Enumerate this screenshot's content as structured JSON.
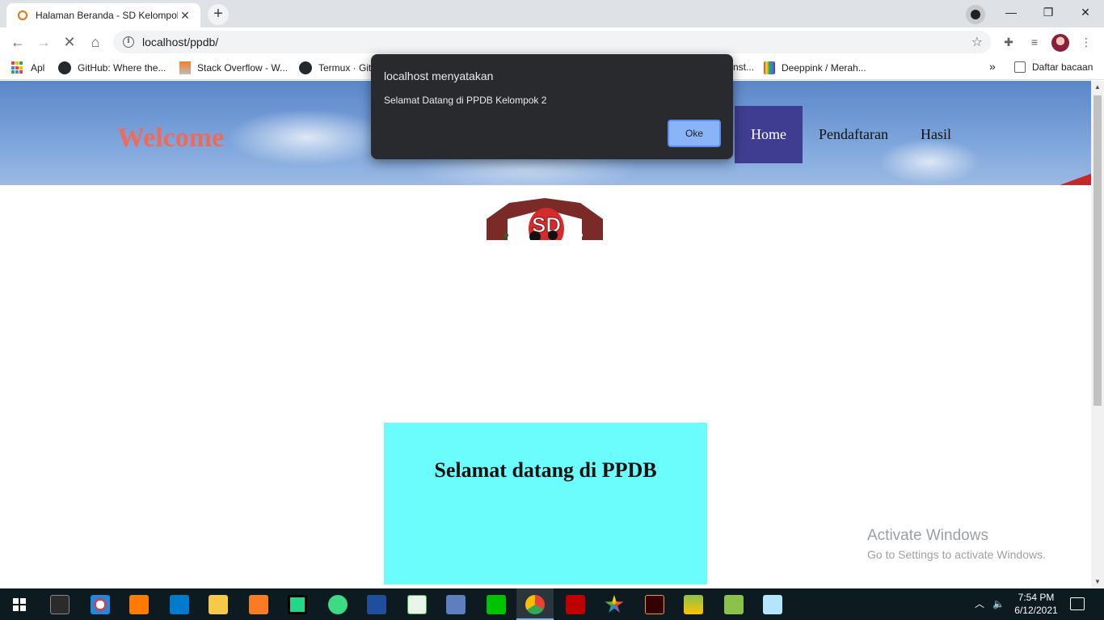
{
  "browser": {
    "tab_title": "Halaman Beranda - SD Kelompok",
    "url": "localhost/ppdb/",
    "bookmarks": [
      {
        "label": "Apl",
        "icon": "apps-grid-icon"
      },
      {
        "label": "GitHub: Where the...",
        "icon": "github-icon"
      },
      {
        "label": "Stack Overflow - W...",
        "icon": "stackoverflow-icon"
      },
      {
        "label": "Termux · Git",
        "icon": "github-icon"
      },
      {
        "label": "nst...",
        "icon": ""
      },
      {
        "label": "Deeppink / Merah...",
        "icon": "rainbow-book-icon"
      }
    ],
    "reading_list": "Daftar bacaan",
    "overflow": "»"
  },
  "site": {
    "welcome": "Welcome",
    "nav": [
      {
        "label": "Home",
        "active": true
      },
      {
        "label": "Pendaftaran",
        "active": false
      },
      {
        "label": "Hasil",
        "active": false
      }
    ],
    "logo_text": "SD",
    "headline": "Selamat datang di PPDB"
  },
  "dialog": {
    "title": "localhost menyatakan",
    "message": "Selamat Datang di PPDB Kelompok 2",
    "ok_label": "Oke"
  },
  "watermark": {
    "line1": "Activate Windows",
    "line2": "Go to Settings to activate Windows."
  },
  "taskbar": {
    "time": "7:54 PM",
    "date": "6/12/2021",
    "apps": [
      "terminal",
      "paint",
      "sublime-text",
      "vscode",
      "file-explorer",
      "xampp",
      "pycharm",
      "android-studio",
      "dev-cpp",
      "notepad",
      "virtualbox",
      "line",
      "chrome",
      "filezilla",
      "star-app",
      "illustrator",
      "bluestacks",
      "android-sdk",
      "notes"
    ]
  },
  "colors": {
    "nav_active": "#3f3d91",
    "welcome_text": "#f06a5c",
    "content_box": "#6bfcfc",
    "dialog_bg": "#292a2d",
    "ok_button": "#8ab4f8"
  }
}
